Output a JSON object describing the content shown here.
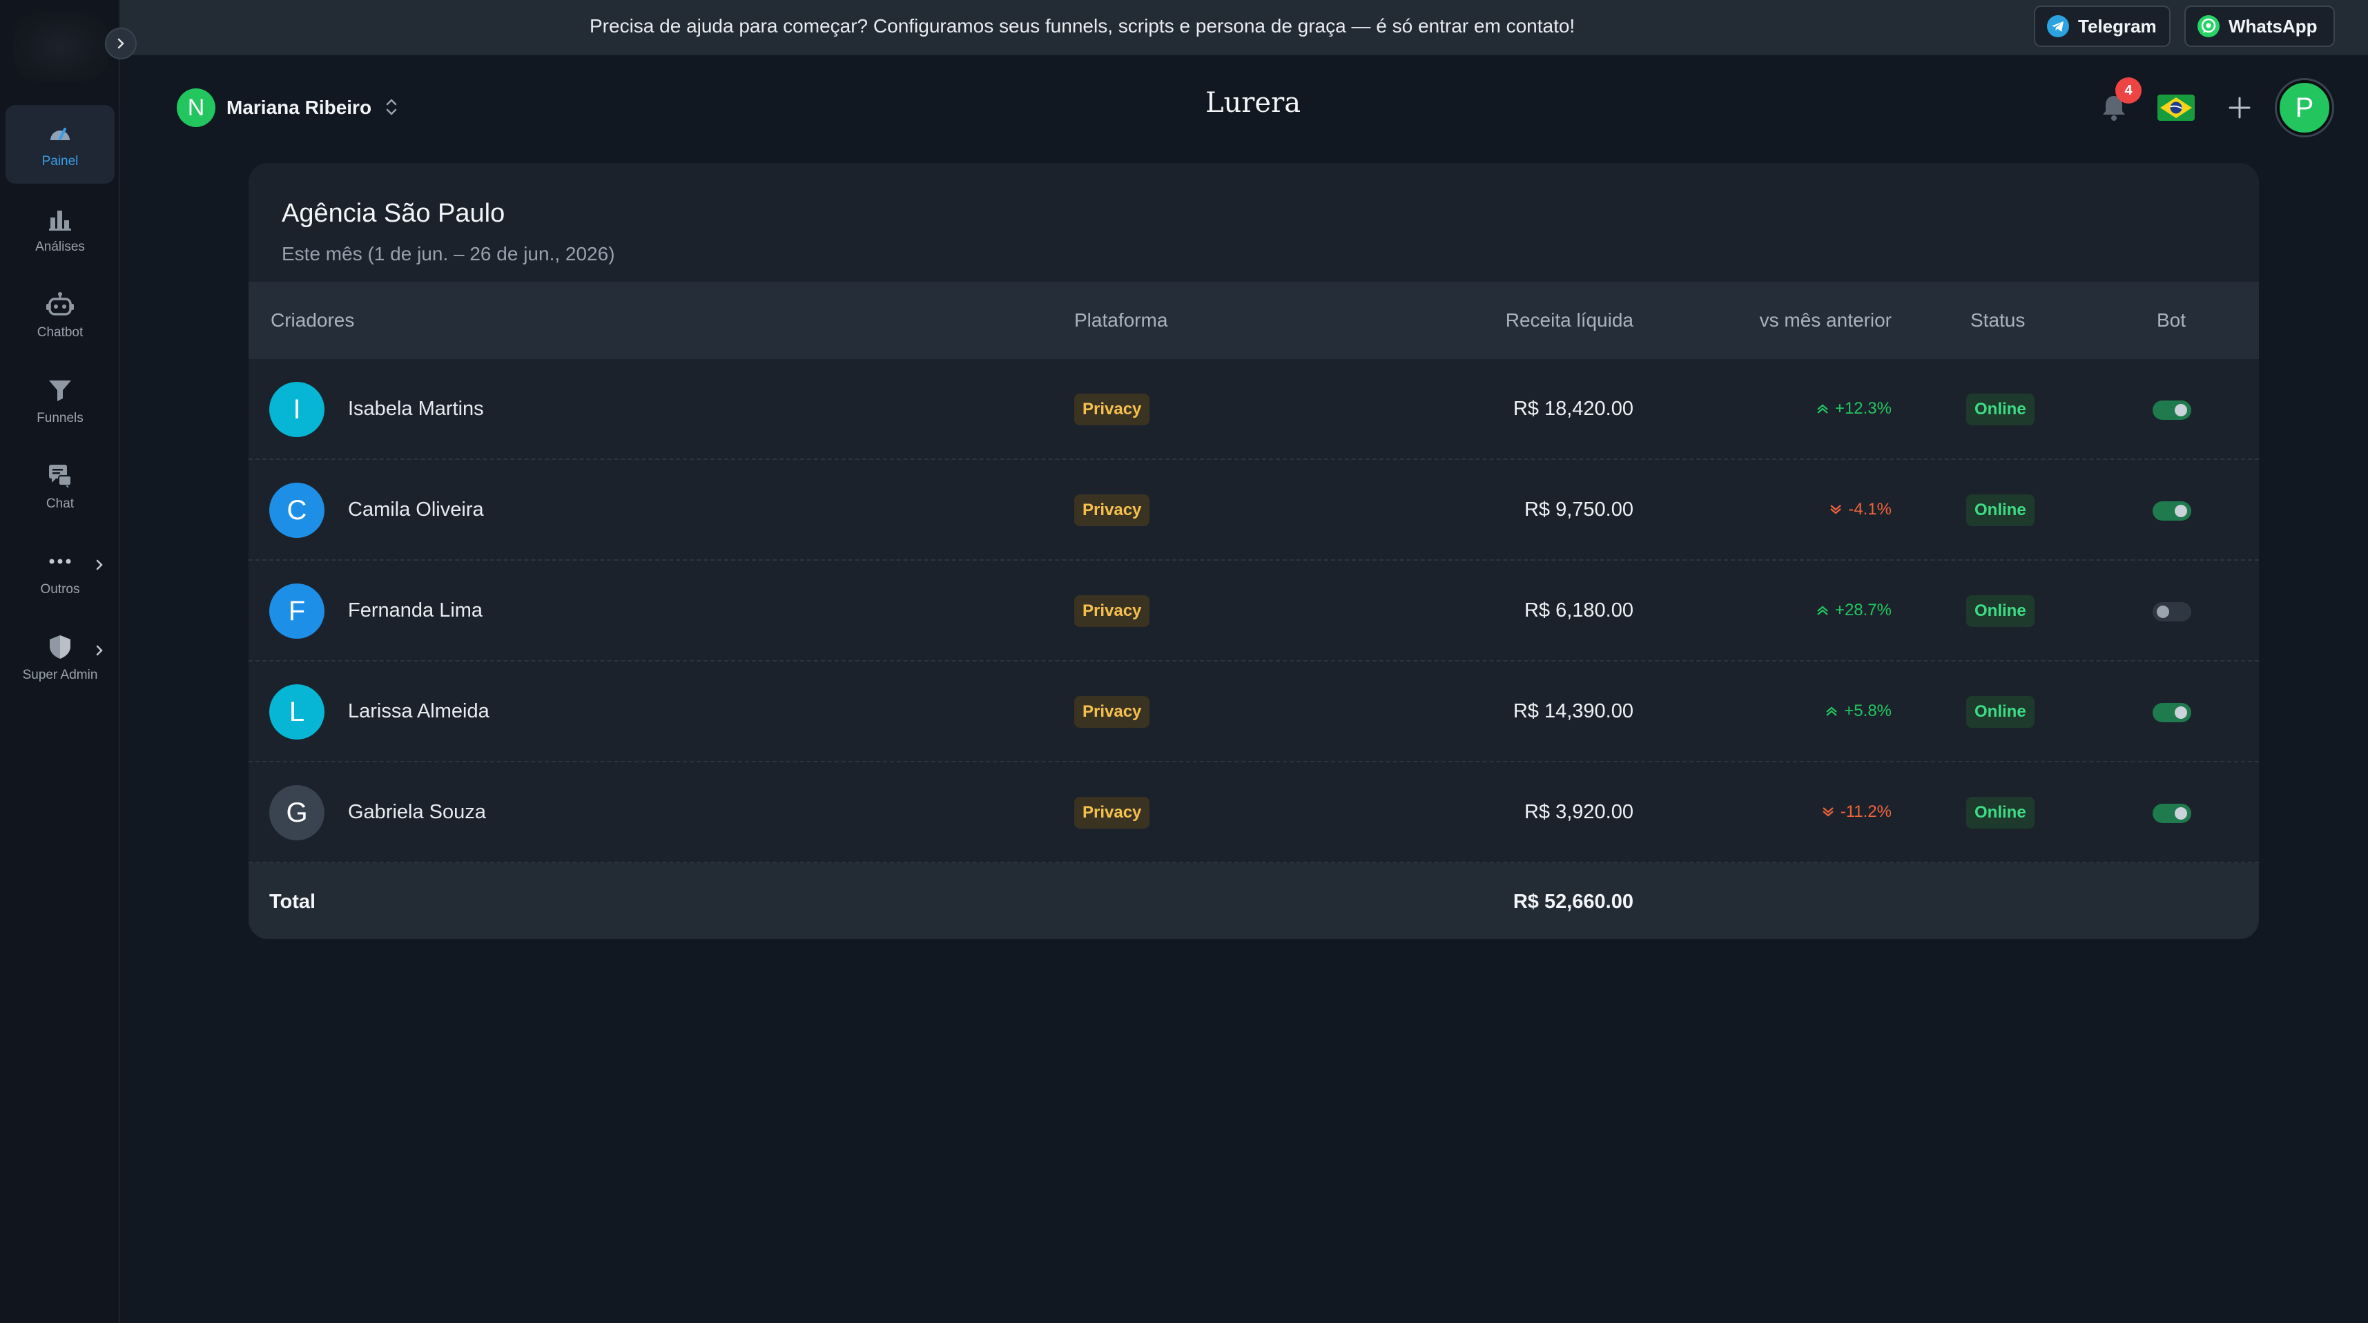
{
  "banner": {
    "text": "Precisa de ajuda para começar? Configuramos seus funnels, scripts e persona de graça — é só entrar em contato!",
    "telegram_label": "Telegram",
    "whatsapp_label": "WhatsApp"
  },
  "sidebar": {
    "items": [
      {
        "label": "Painel",
        "icon": "gauge-icon",
        "active": true
      },
      {
        "label": "Análises",
        "icon": "bar-chart-icon"
      },
      {
        "label": "Chatbot",
        "icon": "robot-icon"
      },
      {
        "label": "Funnels",
        "icon": "funnel-icon"
      },
      {
        "label": "Chat",
        "icon": "chat-icon"
      },
      {
        "label": "Outros",
        "icon": "more-dots-icon",
        "has_submenu": true
      },
      {
        "label": "Super Admin",
        "icon": "shield-icon",
        "has_submenu": true
      }
    ]
  },
  "header": {
    "workspace_initial": "N",
    "workspace_name": "Mariana Ribeiro",
    "logo": "Lurera",
    "notification_count": "4",
    "user_initial": "P"
  },
  "card": {
    "title": "Agência São Paulo",
    "subtitle": "Este mês (1 de jun. – 26 de jun., 2026)",
    "columns": {
      "creators": "Criadores",
      "platform": "Plataforma",
      "revenue": "Receita líquida",
      "vs_prev": "vs mês anterior",
      "status": "Status",
      "bot": "Bot"
    },
    "rows": [
      {
        "initial": "I",
        "name": "Isabela Martins",
        "avatar_color": "#06b6d4",
        "platform": "Privacy",
        "revenue": "R$ 18,420.00",
        "change": "+12.3%",
        "trend": "up",
        "status": "Online",
        "bot_on": true
      },
      {
        "initial": "C",
        "name": "Camila Oliveira",
        "avatar_color": "#1d8fe6",
        "platform": "Privacy",
        "revenue": "R$ 9,750.00",
        "change": "-4.1%",
        "trend": "down",
        "status": "Online",
        "bot_on": true
      },
      {
        "initial": "F",
        "name": "Fernanda Lima",
        "avatar_color": "#1d8fe6",
        "platform": "Privacy",
        "revenue": "R$ 6,180.00",
        "change": "+28.7%",
        "trend": "up",
        "status": "Online",
        "bot_on": false
      },
      {
        "initial": "L",
        "name": "Larissa Almeida",
        "avatar_color": "#06b6d4",
        "platform": "Privacy",
        "revenue": "R$ 14,390.00",
        "change": "+5.8%",
        "trend": "up",
        "status": "Online",
        "bot_on": true
      },
      {
        "initial": "G",
        "name": "Gabriela Souza",
        "avatar_color": "#3a4350",
        "platform": "Privacy",
        "revenue": "R$ 3,920.00",
        "change": "-11.2%",
        "trend": "down",
        "status": "Online",
        "bot_on": true
      }
    ],
    "total_label": "Total",
    "total_value": "R$ 52,660.00"
  }
}
